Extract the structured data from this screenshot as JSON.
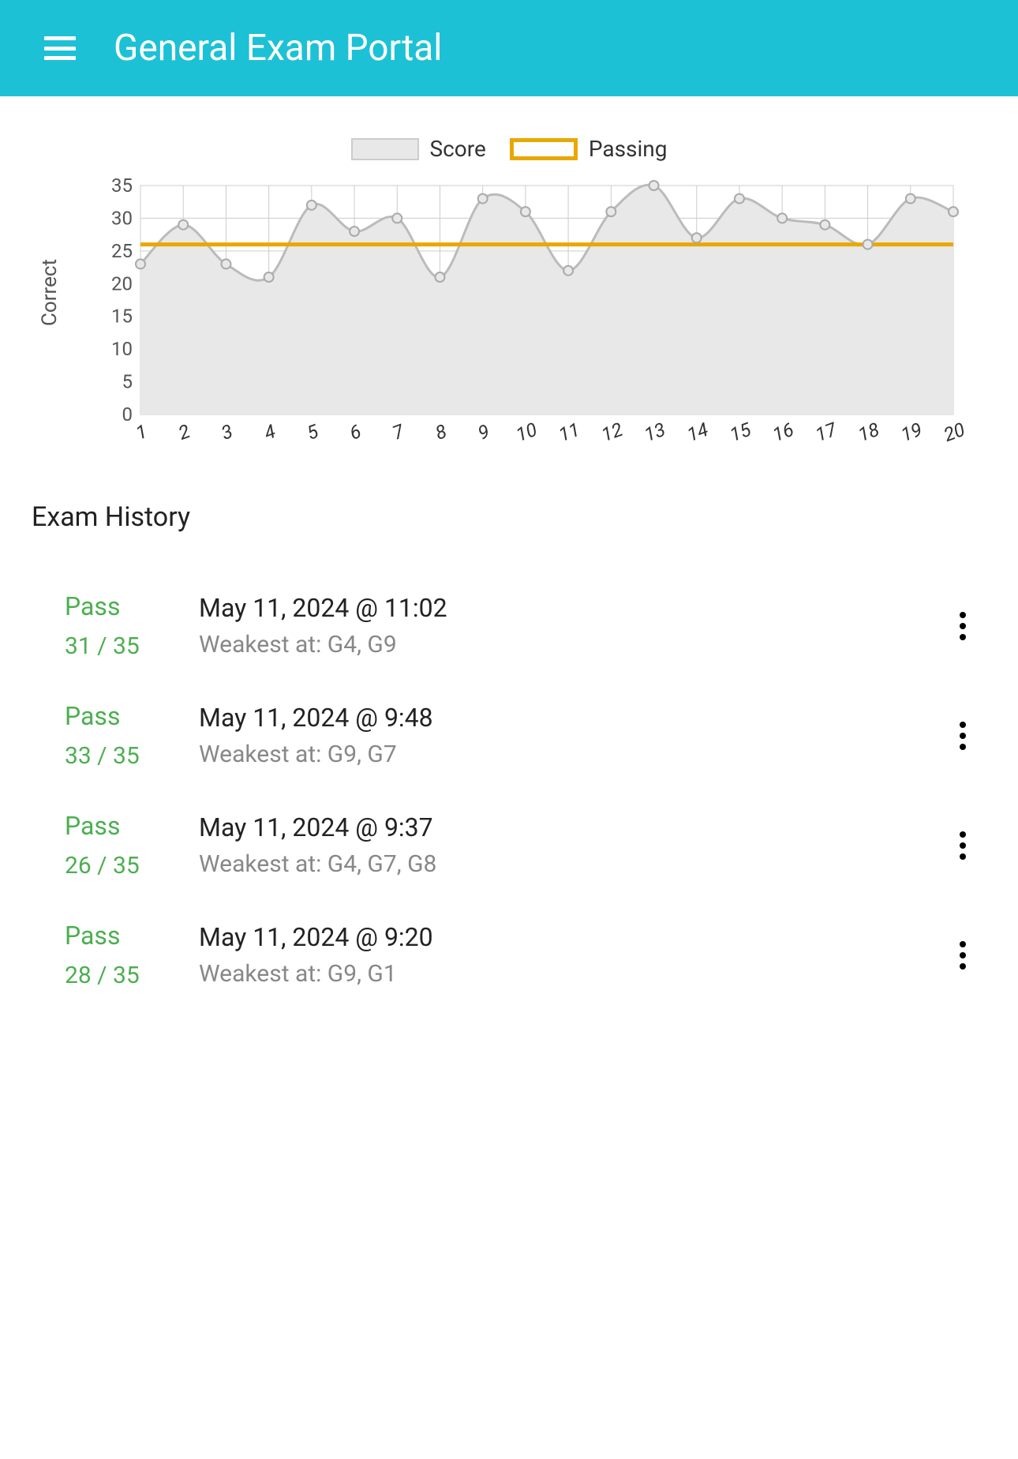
{
  "header": {
    "title": "General Exam Portal"
  },
  "chart": {
    "legend_score": "Score",
    "legend_passing": "Passing",
    "y_label": "Correct"
  },
  "chart_data": {
    "type": "line",
    "categories": [
      "1",
      "2",
      "3",
      "4",
      "5",
      "6",
      "7",
      "8",
      "9",
      "10",
      "11",
      "12",
      "13",
      "14",
      "15",
      "16",
      "17",
      "18",
      "19",
      "20"
    ],
    "series": [
      {
        "name": "Score",
        "values": [
          23,
          29,
          23,
          21,
          32,
          28,
          30,
          21,
          33,
          31,
          22,
          31,
          35,
          27,
          33,
          30,
          29,
          26,
          33,
          31
        ]
      },
      {
        "name": "Passing",
        "values": [
          26,
          26,
          26,
          26,
          26,
          26,
          26,
          26,
          26,
          26,
          26,
          26,
          26,
          26,
          26,
          26,
          26,
          26,
          26,
          26
        ]
      }
    ],
    "xlabel": "",
    "ylabel": "Correct",
    "ylim": [
      0,
      35
    ],
    "y_ticks": [
      0,
      5,
      10,
      15,
      20,
      25,
      30,
      35
    ],
    "passing_threshold": 26
  },
  "history": {
    "title": "Exam History",
    "items": [
      {
        "status": "Pass",
        "score": "31 / 35",
        "date": "May 11, 2024 @ 11:02",
        "weak": "Weakest at: G4, G9"
      },
      {
        "status": "Pass",
        "score": "33 / 35",
        "date": "May 11, 2024 @ 9:48",
        "weak": "Weakest at: G9, G7"
      },
      {
        "status": "Pass",
        "score": "26 / 35",
        "date": "May 11, 2024 @ 9:37",
        "weak": "Weakest at: G4, G7, G8"
      },
      {
        "status": "Pass",
        "score": "28 / 35",
        "date": "May 11, 2024 @ 9:20",
        "weak": "Weakest at: G9, G1"
      }
    ]
  }
}
